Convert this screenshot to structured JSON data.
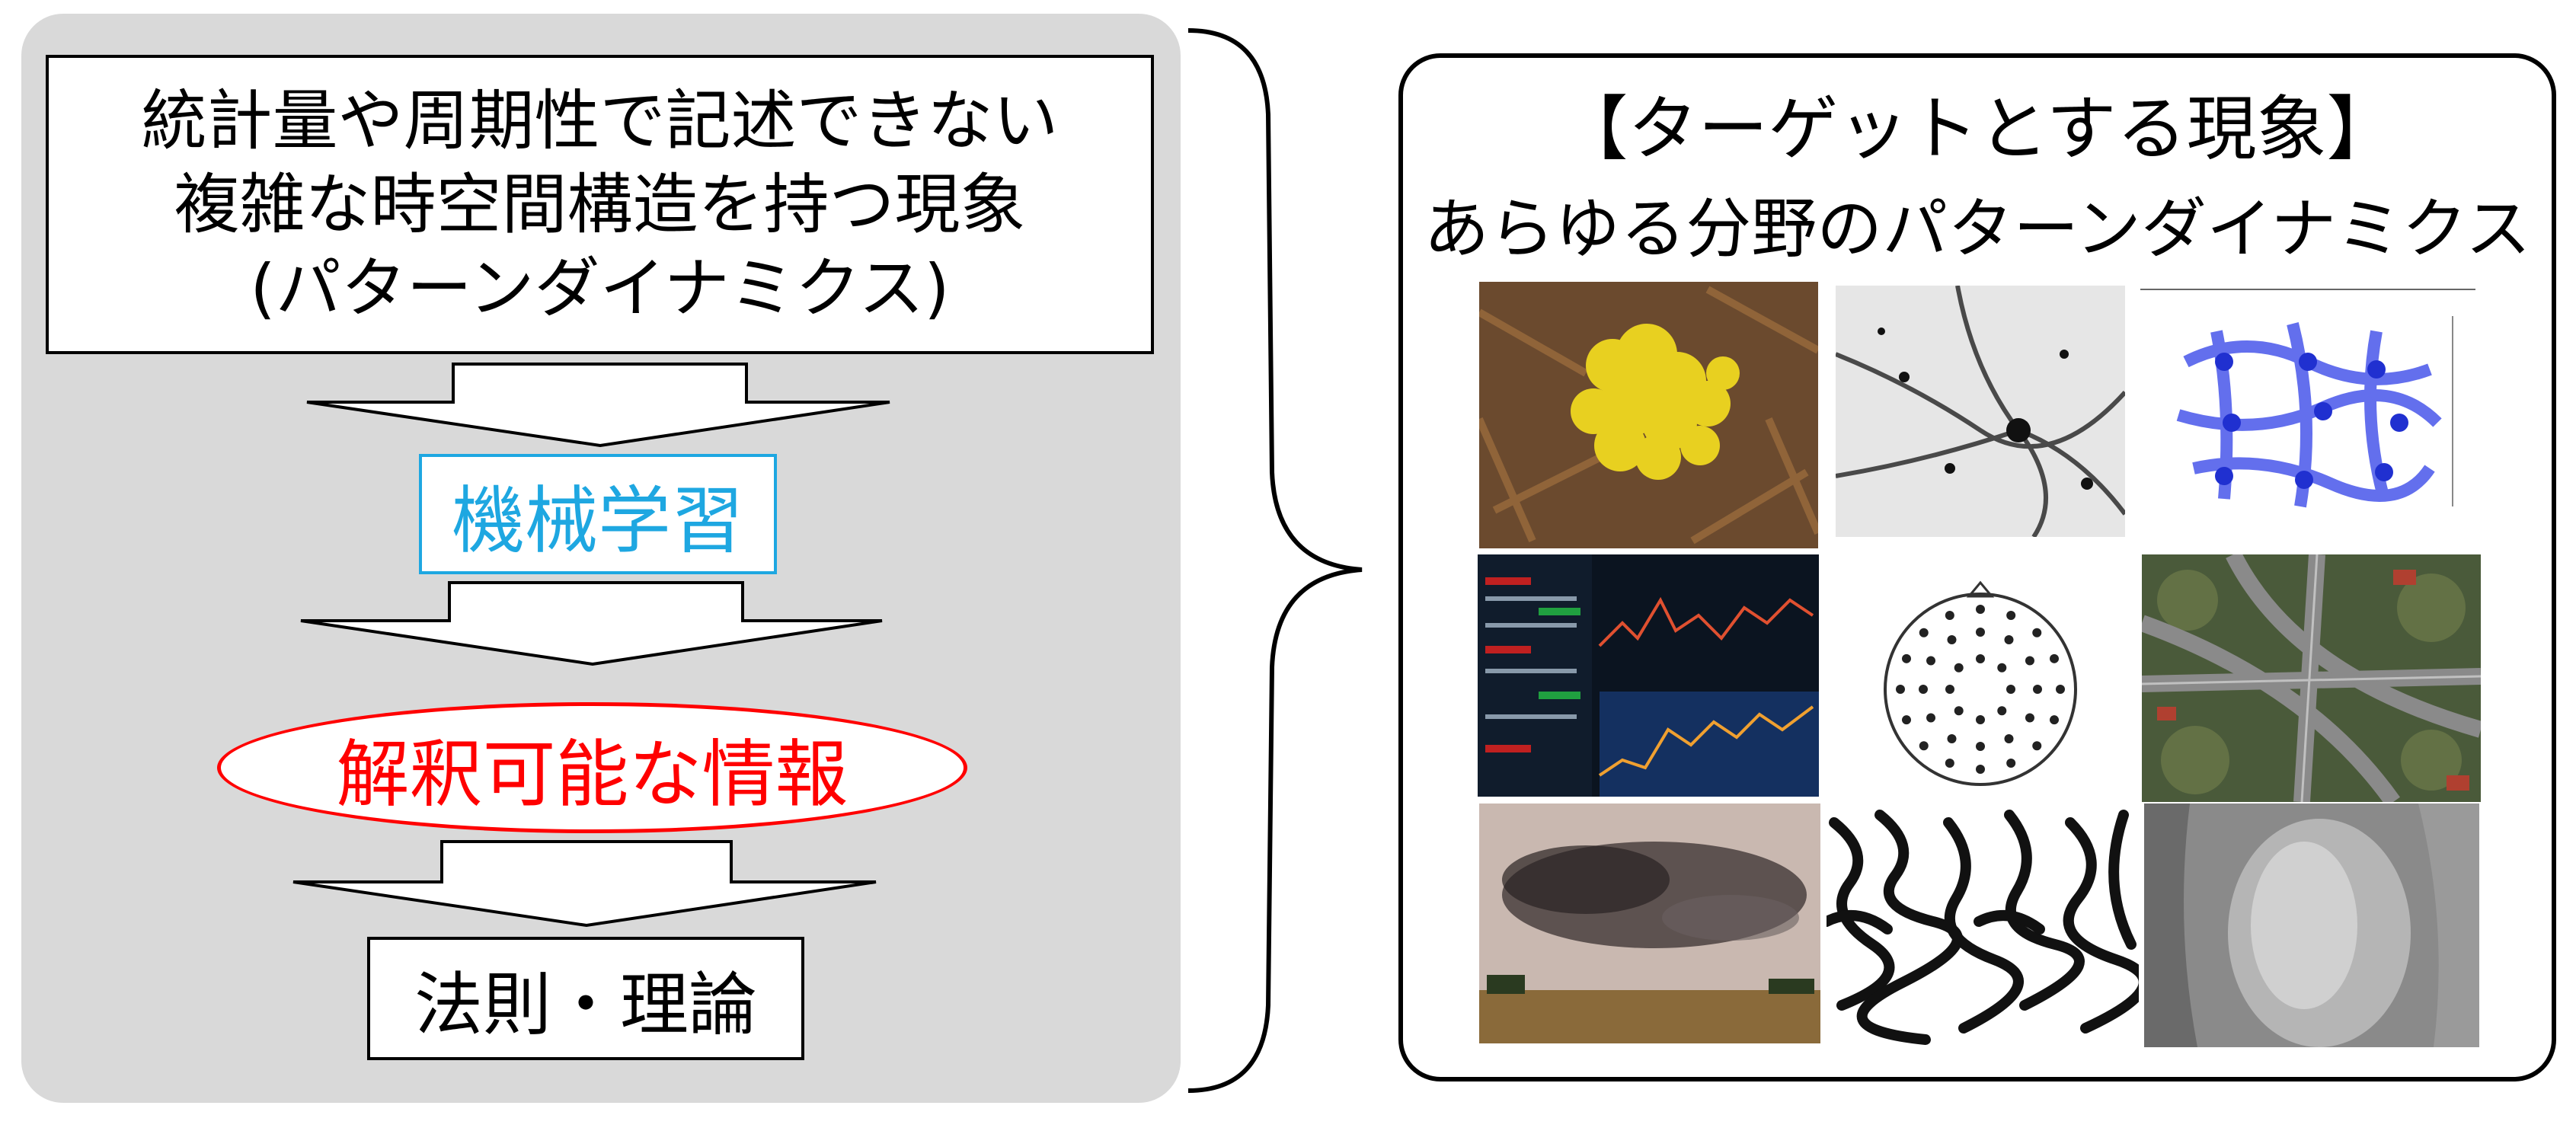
{
  "left": {
    "problem_lines": [
      "統計量や周期性で記述できない",
      "複雑な時空間構造を持つ現象",
      "(パターンダイナミクス)"
    ],
    "ml": "機械学習",
    "interpretable": "解釈可能な情報",
    "law": "法則・理論"
  },
  "right": {
    "title": "【ターゲットとする現象】",
    "subtitle": "あらゆる分野のパターンダイナミクス"
  },
  "colors": {
    "panel": "#d9d9d9",
    "ml": "#1ea7e1",
    "interpretable": "#ff0000"
  }
}
